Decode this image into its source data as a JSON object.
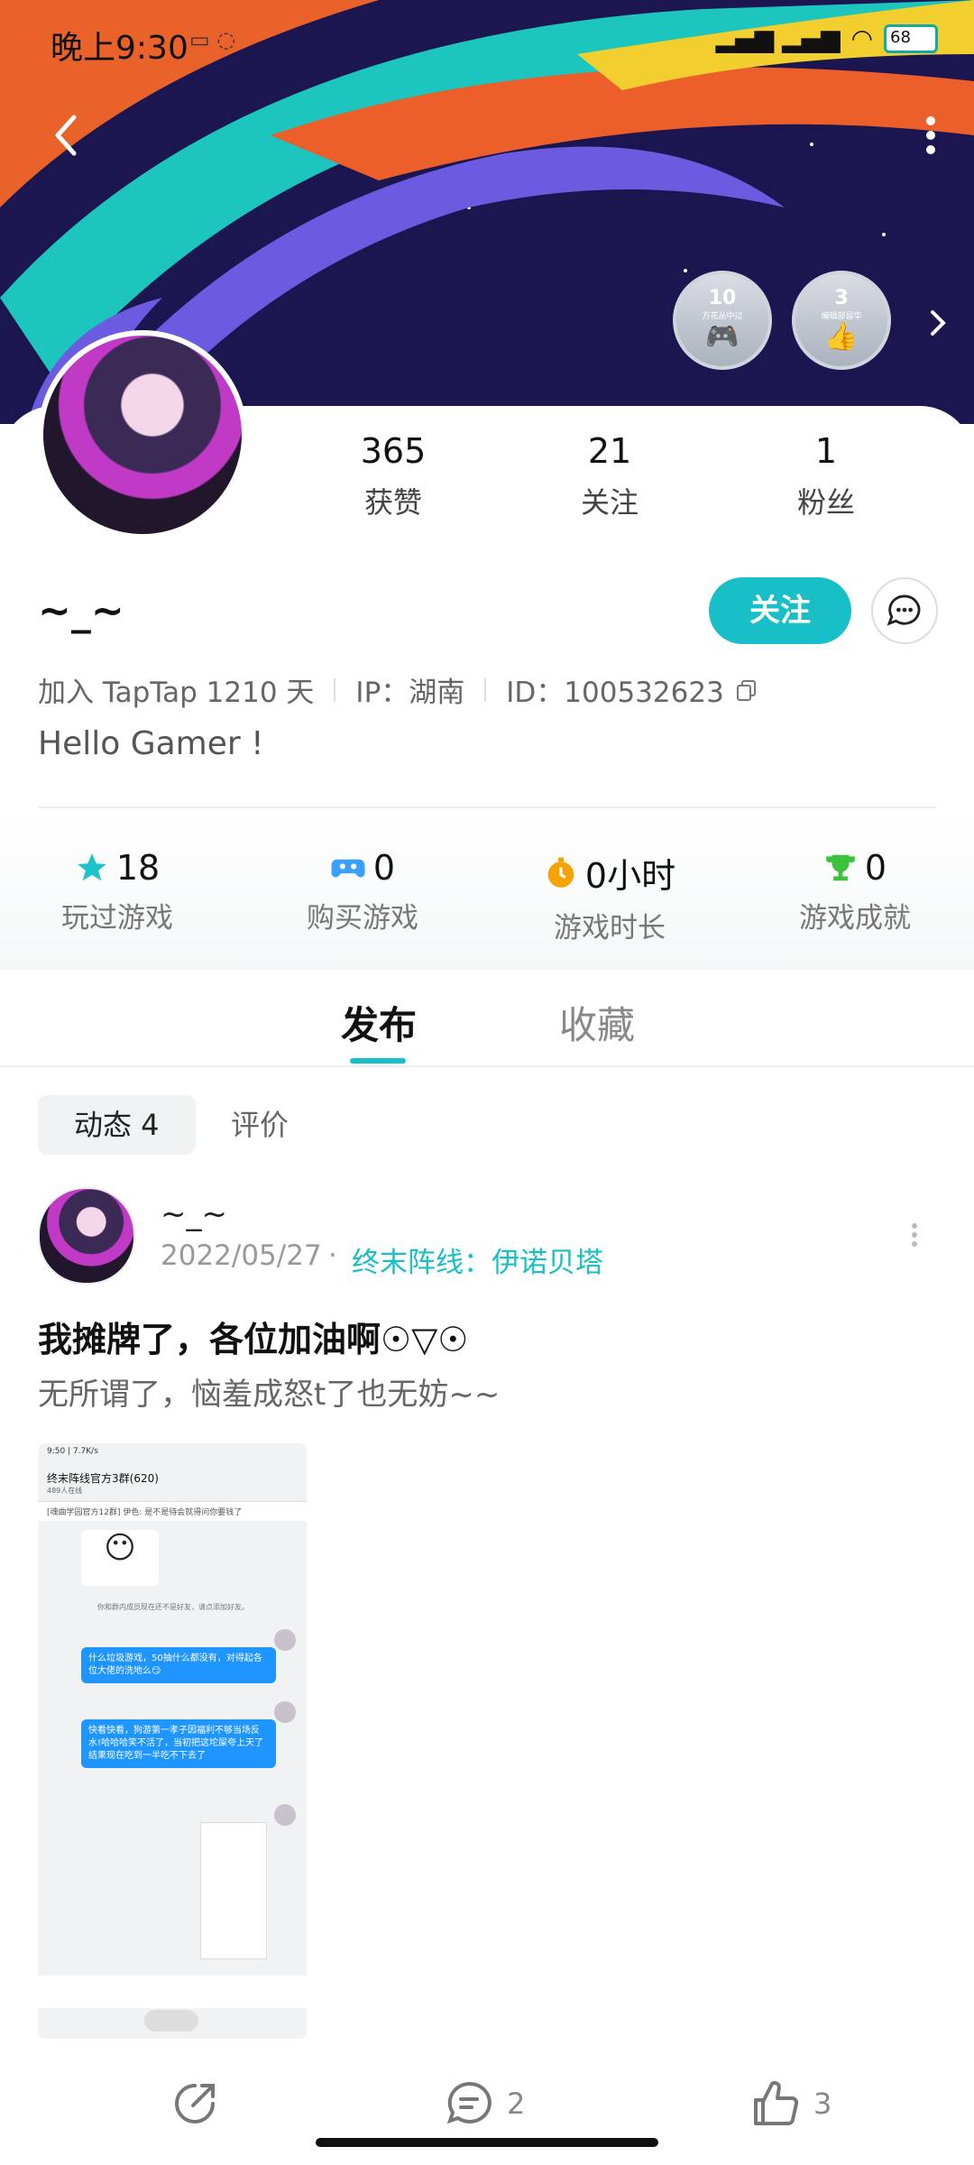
{
  "status_bar": {
    "time": "晚上9:30",
    "battery": "68"
  },
  "header": {
    "badges": [
      {
        "num": "10",
        "label": "万花丛中过"
      },
      {
        "num": "3",
        "label": "编辑部留华"
      }
    ]
  },
  "profile": {
    "stats": [
      {
        "value": "365",
        "label": "获赞"
      },
      {
        "value": "21",
        "label": "关注"
      },
      {
        "value": "1",
        "label": "粉丝"
      }
    ],
    "username": "~_~",
    "follow_label": "关注",
    "join_text": "加入 TapTap 1210 天",
    "ip_text": "IP：湖南",
    "id_text": "ID：100532623",
    "bio": "Hello Gamer !"
  },
  "game_stats": [
    {
      "value": "18",
      "label": "玩过游戏",
      "icon": "star-icon",
      "color": "#1ec3c9"
    },
    {
      "value": "0",
      "label": "购买游戏",
      "icon": "gamepad-icon",
      "color": "#3aa0ff"
    },
    {
      "value": "0小时",
      "label": "游戏时长",
      "icon": "stopwatch-icon",
      "color": "#f4a300"
    },
    {
      "value": "0",
      "label": "游戏成就",
      "icon": "trophy-icon",
      "color": "#3cc23c"
    }
  ],
  "tabs": [
    {
      "label": "发布"
    },
    {
      "label": "收藏"
    }
  ],
  "subtabs": [
    {
      "label": "动态 4"
    },
    {
      "label": "评价"
    }
  ],
  "post": {
    "author": "~_~",
    "date": "2022/05/27",
    "dot": "·",
    "game": "终末阵线：伊诺贝塔",
    "title": "我摊牌了，各位加油啊☉▽☉",
    "text": "无所谓了，恼羞成怒t了也无妨~~",
    "screenshot": {
      "status": "9:50 | 7.7K/s",
      "group_name": "终末阵线官方3群(620)",
      "members": "489人在线",
      "notice": "[魂曲学园官方12群] 伊色: 是不是待会就得问你要钱了",
      "sys_note": "你和群内成员现在还不是好友，请点添加好友。",
      "messages": [
        "什么垃圾游戏，50抽什么都没有，对得起各位大佬的洗地么😏",
        "快看快看，狗游第一孝子因福利不够当场反水!哈哈哈笑不活了，当初把这坨屎夸上天了结果现在吃到一半吃不下去了"
      ]
    }
  },
  "actions": {
    "comments": "2",
    "likes": "3"
  }
}
